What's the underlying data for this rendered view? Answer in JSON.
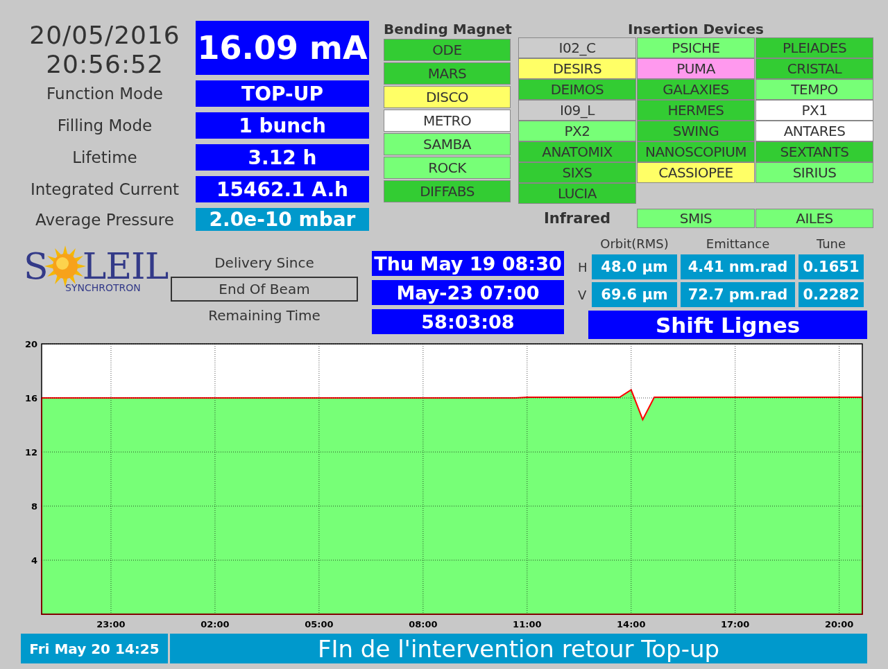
{
  "clock": {
    "date": "20/05/2016",
    "time": "20:56:52"
  },
  "beam_current": "16.09 mA",
  "parameters": [
    {
      "label": "Function Mode",
      "value": "TOP-UP",
      "color": "#0000ff"
    },
    {
      "label": "Filling Mode",
      "value": "1 bunch",
      "color": "#0000ff"
    },
    {
      "label": "Lifetime",
      "value": "3.12 h",
      "color": "#0000ff"
    },
    {
      "label": "Integrated Current",
      "value": "15462.1 A.h",
      "color": "#0000ff"
    },
    {
      "label": "Average Pressure",
      "value": "2.0e-10 mbar",
      "color": "#0099cc"
    }
  ],
  "bending_magnet": {
    "title": "Bending Magnet",
    "beamlines": [
      {
        "name": "ODE",
        "color": "#33cc33"
      },
      {
        "name": "MARS",
        "color": "#33cc33"
      },
      {
        "name": "DISCO",
        "color": "#ffff66"
      },
      {
        "name": "METRO",
        "color": "#ffffff"
      },
      {
        "name": "SAMBA",
        "color": "#77ff77"
      },
      {
        "name": "ROCK",
        "color": "#77ff77"
      },
      {
        "name": "DIFFABS",
        "color": "#33cc33"
      }
    ]
  },
  "insertion_devices": {
    "title": "Insertion Devices",
    "beamlines": [
      {
        "name": "I02_C",
        "color": "#cccccc"
      },
      {
        "name": "PSICHE",
        "color": "#77ff77"
      },
      {
        "name": "PLEIADES",
        "color": "#33cc33"
      },
      {
        "name": "DESIRS",
        "color": "#ffff66"
      },
      {
        "name": "PUMA",
        "color": "#ff99ee"
      },
      {
        "name": "CRISTAL",
        "color": "#33cc33"
      },
      {
        "name": "DEIMOS",
        "color": "#33cc33"
      },
      {
        "name": "GALAXIES",
        "color": "#33cc33"
      },
      {
        "name": "TEMPO",
        "color": "#77ff77"
      },
      {
        "name": "I09_L",
        "color": "#cccccc"
      },
      {
        "name": "HERMES",
        "color": "#33cc33"
      },
      {
        "name": "PX1",
        "color": "#ffffff"
      },
      {
        "name": "PX2",
        "color": "#77ff77"
      },
      {
        "name": "SWING",
        "color": "#33cc33"
      },
      {
        "name": "ANTARES",
        "color": "#ffffff"
      },
      {
        "name": "ANATOMIX",
        "color": "#33cc33"
      },
      {
        "name": "NANOSCOPIUM",
        "color": "#33cc33"
      },
      {
        "name": "SEXTANTS",
        "color": "#33cc33"
      },
      {
        "name": "SIXS",
        "color": "#33cc33"
      },
      {
        "name": "CASSIOPEE",
        "color": "#ffff66"
      },
      {
        "name": "SIRIUS",
        "color": "#77ff77"
      },
      {
        "name": "LUCIA",
        "color": "#33cc33"
      }
    ]
  },
  "infrared": {
    "title": "Infrared",
    "beamlines": [
      {
        "name": "SMIS",
        "color": "#77ff77"
      },
      {
        "name": "AILES",
        "color": "#77ff77"
      }
    ]
  },
  "logo": {
    "left": "S",
    "right": "LEIL",
    "subtitle": "SYNCHROTRON"
  },
  "delivery": {
    "labels": [
      {
        "text": "Delivery Since",
        "selected": false
      },
      {
        "text": "End Of Beam",
        "selected": true
      },
      {
        "text": "Remaining Time",
        "selected": false
      }
    ],
    "values": [
      "Thu May 19 08:30",
      "May-23 07:00",
      "58:03:08"
    ]
  },
  "beam_params": {
    "columns": [
      "Orbit(RMS)",
      "Emittance",
      "Tune"
    ],
    "rows": [
      {
        "plane": "H",
        "values": [
          "48.0 µm",
          "4.41 nm.rad",
          "0.1651"
        ]
      },
      {
        "plane": "V",
        "values": [
          "69.6 µm",
          "72.7 pm.rad",
          "0.2282"
        ]
      }
    ],
    "shift": "Shift Lignes"
  },
  "chart": {
    "chart_data": {
      "type": "area",
      "grid": true,
      "ylim": [
        0,
        20
      ],
      "yticks": [
        4,
        8,
        12,
        16,
        20
      ],
      "categories": [
        null,
        null,
        null,
        null,
        null,
        null,
        "23:00",
        null,
        null,
        null,
        null,
        null,
        null,
        null,
        null,
        "02:00",
        null,
        null,
        null,
        null,
        null,
        null,
        null,
        null,
        "05:00",
        null,
        null,
        null,
        null,
        null,
        null,
        null,
        null,
        "08:00",
        null,
        null,
        null,
        null,
        null,
        null,
        null,
        null,
        "11:00",
        null,
        null,
        null,
        null,
        null,
        null,
        null,
        null,
        "14:00",
        null,
        null,
        null,
        null,
        null,
        null,
        null,
        null,
        "17:00",
        null,
        null,
        null,
        null,
        null,
        null,
        null,
        null,
        "20:00",
        null,
        null
      ],
      "series": [
        {
          "color": "#77ff77",
          "values": [
            16.0,
            16.0,
            16.0,
            16.0,
            16.0,
            16.0,
            16.0,
            16.0,
            16.0,
            16.0,
            16.0,
            16.0,
            16.0,
            16.0,
            16.0,
            16.0,
            16.0,
            16.0,
            16.0,
            16.0,
            16.0,
            16.0,
            16.0,
            16.0,
            16.0,
            16.0,
            16.0,
            16.0,
            16.0,
            16.0,
            16.0,
            16.0,
            16.0,
            16.0,
            16.0,
            16.0,
            16.0,
            16.0,
            16.0,
            16.0,
            16.0,
            16.0,
            16.05,
            16.05,
            16.05,
            16.05,
            16.05,
            16.05,
            16.05,
            16.05,
            16.05,
            16.6,
            14.4,
            16.05,
            16.05,
            16.05,
            16.05,
            16.05,
            16.05,
            16.05,
            16.05,
            16.05,
            16.05,
            16.05,
            16.05,
            16.05,
            16.05,
            16.05,
            16.05,
            16.05,
            16.05,
            16.05
          ]
        }
      ]
    }
  },
  "footer": {
    "date": "Fri May 20 14:25",
    "message": "FIn de l'intervention retour Top-up"
  }
}
